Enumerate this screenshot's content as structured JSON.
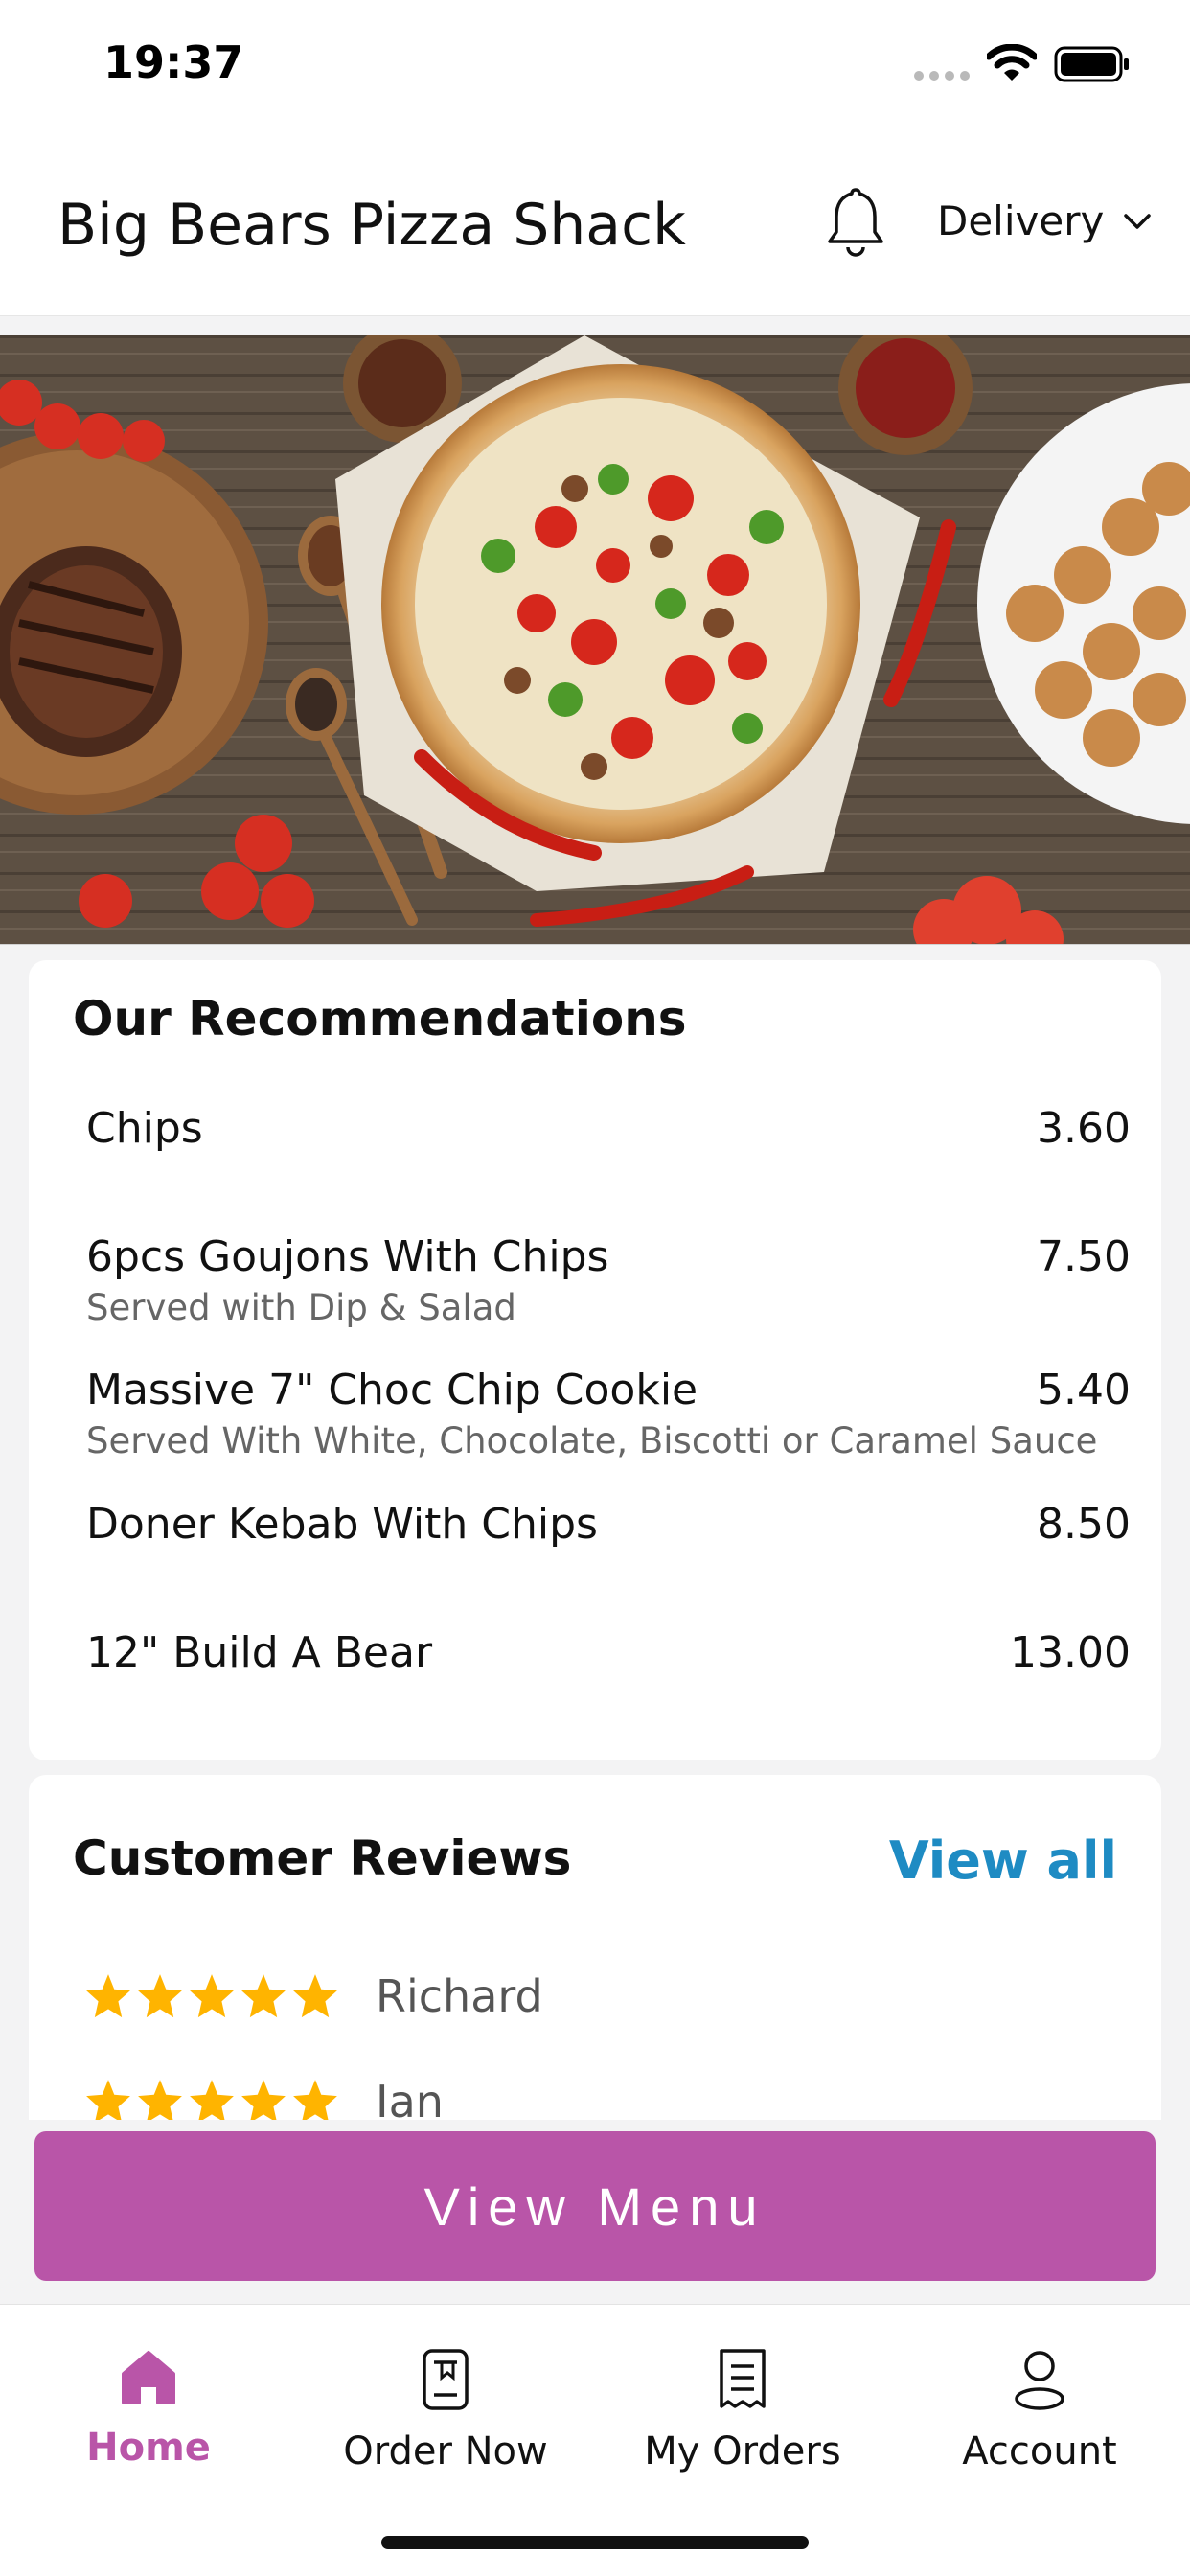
{
  "status_bar": {
    "time": "19:37"
  },
  "header": {
    "restaurant_name": "Big Bears Pizza Shack",
    "delivery_mode": "Delivery"
  },
  "banner": {
    "icon": "food-banner-image"
  },
  "recommendations": {
    "title": "Our Recommendations",
    "items": [
      {
        "name": "Chips",
        "description": "",
        "price": "3.60"
      },
      {
        "name": "6pcs Goujons With Chips",
        "description": "Served with Dip & Salad",
        "price": "7.50"
      },
      {
        "name": "Massive 7\" Choc Chip Cookie",
        "description": "Served With White, Chocolate, Biscotti or Caramel Sauce",
        "price": "5.40"
      },
      {
        "name": "Doner Kebab With Chips",
        "description": "",
        "price": "8.50"
      },
      {
        "name": "12\" Build A Bear",
        "description": "",
        "price": "13.00"
      }
    ]
  },
  "reviews": {
    "title": "Customer Reviews",
    "view_all": "View all",
    "items": [
      {
        "reviewer": "Richard",
        "rating": 5
      },
      {
        "reviewer": "Ian",
        "rating": 5
      }
    ]
  },
  "view_menu_label": "View Menu",
  "nav": {
    "items": [
      {
        "label": "Home",
        "icon": "home-icon",
        "active": true
      },
      {
        "label": "Order Now",
        "icon": "order-icon",
        "active": false
      },
      {
        "label": "My Orders",
        "icon": "receipt-icon",
        "active": false
      },
      {
        "label": "Account",
        "icon": "account-icon",
        "active": false
      }
    ]
  },
  "colors": {
    "accent": "#b955a8",
    "link": "#1e8bc3",
    "star": "#ffb400"
  }
}
